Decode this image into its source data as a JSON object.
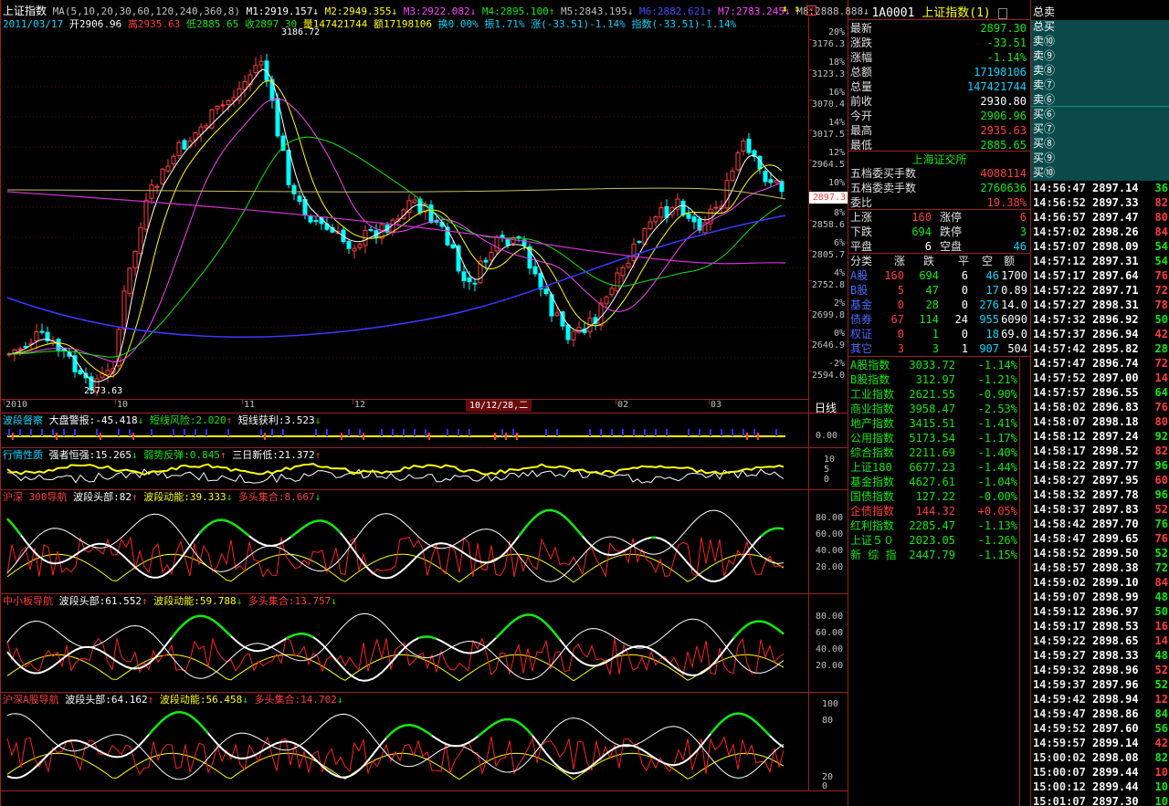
{
  "title_bar": {
    "name": "上证指数",
    "ma_label": "MA(5,10,20,30,60,120,240,360,8)",
    "ma": [
      {
        "label": "M1:2919.157",
        "dir": "↓",
        "color": "#ffffff"
      },
      {
        "label": "M2:2949.355",
        "dir": "↓",
        "color": "#ffff00"
      },
      {
        "label": "M3:2922.082",
        "dir": "↓",
        "color": "#ff40ff"
      },
      {
        "label": "M4:2895.100",
        "dir": "↑",
        "color": "#10e810"
      },
      {
        "label": "M5:2843.195",
        "dir": "↓",
        "color": "#c0c0c0"
      },
      {
        "label": "M6:2882.621",
        "dir": "↑",
        "color": "#4a4aff"
      },
      {
        "label": "M7:2783.245",
        "dir": "↓",
        "color": "#ff40ff"
      },
      {
        "label": "M8:2888.888",
        "dir": "↓",
        "color": "#c0c0c0"
      }
    ]
  },
  "info_bar": {
    "date": "2011/03/17",
    "open": "开2906.96",
    "high": "高2935.63",
    "low": "低2885.65",
    "close": "收2897.30",
    "vol": "量147421744",
    "amt": "额17198106",
    "turn": "换0.00%",
    "amp": "振1.71%",
    "chg": "涨(-33.51)-1.14%",
    "idx": "指数(-33.51)-1.14%"
  },
  "price_axis": [
    {
      "pct": "20%",
      "p": "3176.3"
    },
    {
      "pct": "18%",
      "p": "3123.3"
    },
    {
      "pct": "16%",
      "p": "3070.4"
    },
    {
      "pct": "14%",
      "p": "3017.5"
    },
    {
      "pct": "12%",
      "p": "2964.5"
    },
    {
      "pct": "10%",
      "p": ""
    },
    {
      "pct": "8%",
      "p": "2858.6"
    },
    {
      "pct": "6%",
      "p": "2805.7"
    },
    {
      "pct": "4%",
      "p": "2752.8"
    },
    {
      "pct": "2%",
      "p": "2699.8"
    },
    {
      "pct": "0%",
      "p": "2646.9"
    },
    {
      "pct": "-2%",
      "p": "2594.0"
    }
  ],
  "cur_price": "2897.3",
  "peak_label": "3186.72",
  "trough_label": "2573.63",
  "date_axis": [
    "2010",
    "10",
    "11",
    "12",
    "02",
    "03"
  ],
  "date_cursor": "10/12/28,二",
  "period": "日线",
  "panels": {
    "p1": {
      "name": "波段督察",
      "a": "大盘警报:-45.418",
      "a_dir": "↓",
      "b": "短线风险:2.020",
      "b_dir": "↑",
      "c": "短线获利:3.523",
      "c_dir": "↓",
      "ticks": [
        "0.00"
      ]
    },
    "p2": {
      "name": "行情性质",
      "a": "强者恒强:15.265",
      "a_dir": "↓",
      "b": "弱势反弹:0.845",
      "b_dir": "↑",
      "c": "三日新低:21.372",
      "c_dir": "↑",
      "ticks": [
        "10",
        "5",
        "0"
      ]
    },
    "p3": {
      "name": "沪深 300导航",
      "a": "波段头部:82",
      "a_dir": "↑",
      "b": "波段动能:39.333",
      "b_dir": "↓",
      "c": "多头集合:8.667",
      "c_dir": "↓",
      "ticks": [
        "80.00",
        "60.00",
        "40.00",
        "20.00"
      ]
    },
    "p4": {
      "name": "中小板导航",
      "a": "波段头部:61.552",
      "a_dir": "↑",
      "b": "波段动能:59.788",
      "b_dir": "↓",
      "c": "多头集合:13.757",
      "c_dir": "↓",
      "ticks": [
        "80.00",
        "60.00",
        "40.00",
        "20.00"
      ]
    },
    "p5": {
      "name": "沪深A股导航",
      "a": "波段头部:64.162",
      "a_dir": "↑",
      "b": "波段动能:56.458",
      "b_dir": "↓",
      "c": "多头集合:14.702",
      "c_dir": "↓",
      "ticks": [
        "100",
        "80",
        "20",
        "0"
      ]
    }
  },
  "quote": {
    "code": "1A0001",
    "name": "上证指数",
    "badge": "(1)",
    "rows1": [
      {
        "k": "最新",
        "v": "2897.30",
        "c": "grn"
      },
      {
        "k": "涨跌",
        "v": "-33.51",
        "c": "grn"
      },
      {
        "k": "涨幅",
        "v": "-1.14%",
        "c": "grn"
      },
      {
        "k": "总额",
        "v": "17198106",
        "c": "cyn"
      },
      {
        "k": "总量",
        "v": "147421744",
        "c": "cyn"
      },
      {
        "k": "前收",
        "v": "2930.80",
        "c": "wht"
      },
      {
        "k": "今开",
        "v": "2906.96",
        "c": "grn"
      },
      {
        "k": "最高",
        "v": "2935.63",
        "c": "red"
      },
      {
        "k": "最低",
        "v": "2885.65",
        "c": "grn"
      }
    ],
    "exchange": "上海证交所",
    "rows2": [
      {
        "k": "五档委买手数",
        "v": "4088114",
        "c": "red"
      },
      {
        "k": "五档委卖手数",
        "v": "2760636",
        "c": "grn"
      },
      {
        "k": "委比",
        "v": "19.38%",
        "c": "red"
      }
    ],
    "updown": [
      {
        "k": "上涨",
        "v": "160",
        "c": "red",
        "k2": "涨停",
        "v2": "6",
        "c2": "red"
      },
      {
        "k": "下跌",
        "v": "694",
        "c": "grn",
        "k2": "跌停",
        "v2": "3",
        "c2": "grn"
      },
      {
        "k": "平盘",
        "v": "6",
        "c": "wht",
        "k2": "空盘",
        "v2": "46",
        "c2": "cyn"
      }
    ],
    "cat_header": [
      "分类",
      "涨",
      "跌",
      "平",
      "空",
      "额"
    ],
    "cats": [
      {
        "n": "A股",
        "a": "160",
        "b": "694",
        "c": "6",
        "d": "46",
        "e": "1700"
      },
      {
        "n": "B股",
        "a": "5",
        "b": "47",
        "c": "0",
        "d": "17",
        "e": "0.89"
      },
      {
        "n": "基金",
        "a": "0",
        "b": "28",
        "c": "0",
        "d": "276",
        "e": "14.0"
      },
      {
        "n": "债券",
        "a": "67",
        "b": "114",
        "c": "24",
        "d": "955",
        "e": "6090"
      },
      {
        "n": "权证",
        "a": "0",
        "b": "1",
        "c": "0",
        "d": "18",
        "e": "69.0"
      },
      {
        "n": "其它",
        "a": "3",
        "b": "3",
        "c": "1",
        "d": "907",
        "e": "504"
      }
    ],
    "indices": [
      {
        "n": "A股指数",
        "v": "3033.72",
        "p": "-1.14%",
        "c": "grn"
      },
      {
        "n": "B股指数",
        "v": "312.97",
        "p": "-1.21%",
        "c": "grn"
      },
      {
        "n": "工业指数",
        "v": "2621.55",
        "p": "-0.90%",
        "c": "grn"
      },
      {
        "n": "商业指数",
        "v": "3958.47",
        "p": "-2.53%",
        "c": "grn"
      },
      {
        "n": "地产指数",
        "v": "3415.51",
        "p": "-1.41%",
        "c": "grn"
      },
      {
        "n": "公用指数",
        "v": "5173.54",
        "p": "-1.17%",
        "c": "grn"
      },
      {
        "n": "综合指数",
        "v": "2211.69",
        "p": "-1.40%",
        "c": "grn"
      },
      {
        "n": "上证180",
        "v": "6677.23",
        "p": "-1.44%",
        "c": "grn"
      },
      {
        "n": "基金指数",
        "v": "4627.61",
        "p": "-1.04%",
        "c": "grn"
      },
      {
        "n": "国债指数",
        "v": "127.22",
        "p": "-0.00%",
        "c": "grn"
      },
      {
        "n": "企债指数",
        "v": "144.32",
        "p": "+0.05%",
        "c": "red"
      },
      {
        "n": "红利指数",
        "v": "2285.47",
        "p": "-1.13%",
        "c": "grn"
      },
      {
        "n": "上证５０",
        "v": "2023.05",
        "p": "-1.26%",
        "c": "grn"
      },
      {
        "n": "新 综 指",
        "v": "2447.79",
        "p": "-1.15%",
        "c": "grn"
      }
    ]
  },
  "book": {
    "sell_total": "总卖",
    "buy_total": "总买",
    "sells": [
      "卖⑩",
      "卖⑨",
      "卖⑧",
      "卖⑦",
      "卖⑥"
    ],
    "buys": [
      "买⑥",
      "买⑦",
      "买⑧",
      "买⑨",
      "买⑩"
    ]
  },
  "ticks": [
    {
      "t": "14:56:47",
      "p": "2897.14",
      "pc": "wht",
      "v": "36",
      "vc": "grn"
    },
    {
      "t": "14:56:52",
      "p": "2897.33",
      "pc": "wht",
      "v": "82",
      "vc": "red"
    },
    {
      "t": "14:56:57",
      "p": "2897.47",
      "pc": "wht",
      "v": "80",
      "vc": "red"
    },
    {
      "t": "14:57:02",
      "p": "2898.26",
      "pc": "wht",
      "v": "84",
      "vc": "red"
    },
    {
      "t": "14:57:07",
      "p": "2898.09",
      "pc": "wht",
      "v": "54",
      "vc": "grn"
    },
    {
      "t": "14:57:12",
      "p": "2897.31",
      "pc": "wht",
      "v": "54",
      "vc": "grn"
    },
    {
      "t": "14:57:17",
      "p": "2897.64",
      "pc": "wht",
      "v": "76",
      "vc": "red"
    },
    {
      "t": "14:57:22",
      "p": "2897.71",
      "pc": "wht",
      "v": "72",
      "vc": "red"
    },
    {
      "t": "14:57:27",
      "p": "2898.31",
      "pc": "wht",
      "v": "78",
      "vc": "red"
    },
    {
      "t": "14:57:32",
      "p": "2896.92",
      "pc": "wht",
      "v": "50",
      "vc": "grn"
    },
    {
      "t": "14:57:37",
      "p": "2896.94",
      "pc": "wht",
      "v": "42",
      "vc": "red"
    },
    {
      "t": "14:57:42",
      "p": "2895.82",
      "pc": "wht",
      "v": "28",
      "vc": "grn"
    },
    {
      "t": "14:57:47",
      "p": "2896.74",
      "pc": "wht",
      "v": "72",
      "vc": "red"
    },
    {
      "t": "14:57:52",
      "p": "2897.00",
      "pc": "wht",
      "v": "14",
      "vc": "red"
    },
    {
      "t": "14:57:57",
      "p": "2896.55",
      "pc": "wht",
      "v": "64",
      "vc": "grn"
    },
    {
      "t": "14:58:02",
      "p": "2896.83",
      "pc": "wht",
      "v": "76",
      "vc": "red"
    },
    {
      "t": "14:58:07",
      "p": "2898.18",
      "pc": "wht",
      "v": "80",
      "vc": "red"
    },
    {
      "t": "14:58:12",
      "p": "2897.24",
      "pc": "wht",
      "v": "92",
      "vc": "grn"
    },
    {
      "t": "14:58:17",
      "p": "2898.52",
      "pc": "wht",
      "v": "82",
      "vc": "red"
    },
    {
      "t": "14:58:22",
      "p": "2897.77",
      "pc": "wht",
      "v": "96",
      "vc": "grn"
    },
    {
      "t": "14:58:27",
      "p": "2897.95",
      "pc": "wht",
      "v": "60",
      "vc": "red"
    },
    {
      "t": "14:58:32",
      "p": "2897.78",
      "pc": "wht",
      "v": "96",
      "vc": "grn"
    },
    {
      "t": "14:58:37",
      "p": "2897.83",
      "pc": "wht",
      "v": "52",
      "vc": "red"
    },
    {
      "t": "14:58:42",
      "p": "2897.70",
      "pc": "wht",
      "v": "76",
      "vc": "grn"
    },
    {
      "t": "14:58:47",
      "p": "2899.65",
      "pc": "wht",
      "v": "76",
      "vc": "red"
    },
    {
      "t": "14:58:52",
      "p": "2899.50",
      "pc": "wht",
      "v": "52",
      "vc": "grn"
    },
    {
      "t": "14:58:57",
      "p": "2898.38",
      "pc": "wht",
      "v": "72",
      "vc": "grn"
    },
    {
      "t": "14:59:02",
      "p": "2899.10",
      "pc": "wht",
      "v": "84",
      "vc": "red"
    },
    {
      "t": "14:59:07",
      "p": "2898.99",
      "pc": "wht",
      "v": "48",
      "vc": "grn"
    },
    {
      "t": "14:59:12",
      "p": "2896.97",
      "pc": "wht",
      "v": "50",
      "vc": "grn"
    },
    {
      "t": "14:59:17",
      "p": "2898.53",
      "pc": "wht",
      "v": "16",
      "vc": "red"
    },
    {
      "t": "14:59:22",
      "p": "2898.65",
      "pc": "wht",
      "v": "14",
      "vc": "red"
    },
    {
      "t": "14:59:27",
      "p": "2898.33",
      "pc": "wht",
      "v": "48",
      "vc": "grn"
    },
    {
      "t": "14:59:32",
      "p": "2898.96",
      "pc": "wht",
      "v": "52",
      "vc": "red"
    },
    {
      "t": "14:59:37",
      "p": "2897.96",
      "pc": "wht",
      "v": "52",
      "vc": "grn"
    },
    {
      "t": "14:59:42",
      "p": "2898.94",
      "pc": "wht",
      "v": "12",
      "vc": "red"
    },
    {
      "t": "14:59:47",
      "p": "2898.86",
      "pc": "wht",
      "v": "84",
      "vc": "grn"
    },
    {
      "t": "14:59:52",
      "p": "2897.60",
      "pc": "wht",
      "v": "56",
      "vc": "grn"
    },
    {
      "t": "14:59:57",
      "p": "2899.14",
      "pc": "wht",
      "v": "42",
      "vc": "red"
    },
    {
      "t": "15:00:02",
      "p": "2898.08",
      "pc": "wht",
      "v": "82",
      "vc": "grn"
    },
    {
      "t": "15:00:07",
      "p": "2899.44",
      "pc": "wht",
      "v": "10",
      "vc": "red"
    },
    {
      "t": "15:00:12",
      "p": "2899.44",
      "pc": "wht",
      "v": "10",
      "vc": "grn"
    },
    {
      "t": "15:01:07",
      "p": "2897.30",
      "pc": "wht",
      "v": "10",
      "vc": "grn"
    }
  ]
}
